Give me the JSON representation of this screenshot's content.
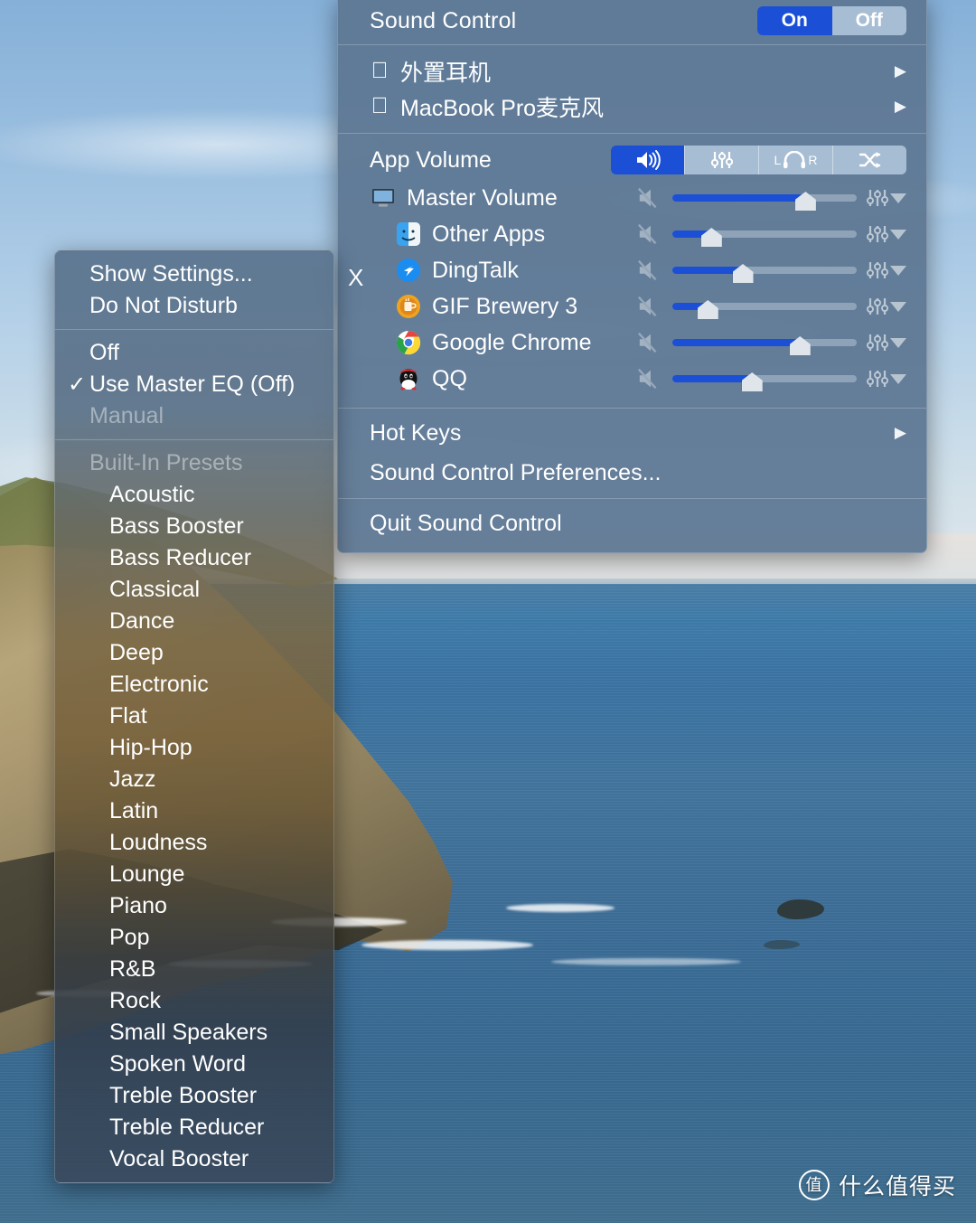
{
  "wallpaper": {
    "scene": "coastal-cliff-ocean"
  },
  "watermark": {
    "badge": "值",
    "text": "什么值得买"
  },
  "sound_menu": {
    "title": "Sound Control",
    "power_toggle": {
      "on_label": "On",
      "off_label": "Off",
      "state": "On"
    },
    "devices": [
      {
        "icon": "apple-logo",
        "label": "外置耳机",
        "submenu_arrow": "▶"
      },
      {
        "icon": "apple-logo",
        "label": "MacBook Pro麦克风",
        "submenu_arrow": "▶"
      }
    ],
    "app_volume": {
      "label": "App Volume",
      "modes": [
        {
          "name": "volume-mode",
          "icon": "speaker-icon",
          "active": true
        },
        {
          "name": "equalizer-mode",
          "icon": "sliders-icon",
          "active": false
        },
        {
          "name": "balance-mode",
          "icon": "headphones-icon",
          "left": "L",
          "right": "R",
          "active": false
        },
        {
          "name": "shuffle-mode",
          "icon": "shuffle-icon",
          "active": false
        }
      ],
      "rows": [
        {
          "icon": "display-icon",
          "name": "Master Volume",
          "indent": 1,
          "volume": 72,
          "muted": false,
          "closeable": false
        },
        {
          "icon": "finder-icon",
          "name": "Other Apps",
          "indent": 2,
          "volume": 21,
          "muted": false,
          "closeable": false
        },
        {
          "icon": "dingtalk-icon",
          "name": "DingTalk",
          "indent": 2,
          "volume": 38,
          "muted": false,
          "closeable": true
        },
        {
          "icon": "gifbrewery-icon",
          "name": "GIF Brewery 3",
          "indent": 2,
          "volume": 19,
          "muted": false,
          "closeable": false
        },
        {
          "icon": "chrome-icon",
          "name": "Google Chrome",
          "indent": 2,
          "volume": 69,
          "muted": false,
          "closeable": false
        },
        {
          "icon": "qq-icon",
          "name": "QQ",
          "indent": 2,
          "volume": 43,
          "muted": false,
          "closeable": false
        }
      ],
      "close_glyph": "X"
    },
    "items": [
      {
        "label": "Hot Keys",
        "submenu_arrow": "▶"
      },
      {
        "label": "Sound Control Preferences...",
        "submenu_arrow": ""
      }
    ],
    "quit_label": "Quit Sound Control"
  },
  "eq_menu": {
    "top_items": [
      {
        "label": "Show Settings...",
        "enabled": true,
        "checked": false
      },
      {
        "label": "Do Not Disturb",
        "enabled": true,
        "checked": false
      }
    ],
    "mode_items": [
      {
        "label": "Off",
        "enabled": true,
        "checked": false
      },
      {
        "label": "Use Master EQ (Off)",
        "enabled": true,
        "checked": true
      },
      {
        "label": "Manual",
        "enabled": false,
        "checked": false
      }
    ],
    "check_glyph": "✓",
    "presets_header": "Built-In Presets",
    "presets": [
      "Acoustic",
      "Bass Booster",
      "Bass Reducer",
      "Classical",
      "Dance",
      "Deep",
      "Electronic",
      "Flat",
      "Hip-Hop",
      "Jazz",
      "Latin",
      "Loudness",
      "Lounge",
      "Piano",
      "Pop",
      "R&B",
      "Rock",
      "Small Speakers",
      "Spoken Word",
      "Treble Booster",
      "Treble Reducer",
      "Vocal Booster"
    ]
  },
  "colors": {
    "menu_bg": "#5c7692",
    "accent_blue": "#1a4fd6",
    "segment_inactive": "#a7bdd3",
    "slider_track": "#8fa3b8",
    "text": "#ffffff",
    "disabled_text": "rgba(255,255,255,0.42)"
  }
}
